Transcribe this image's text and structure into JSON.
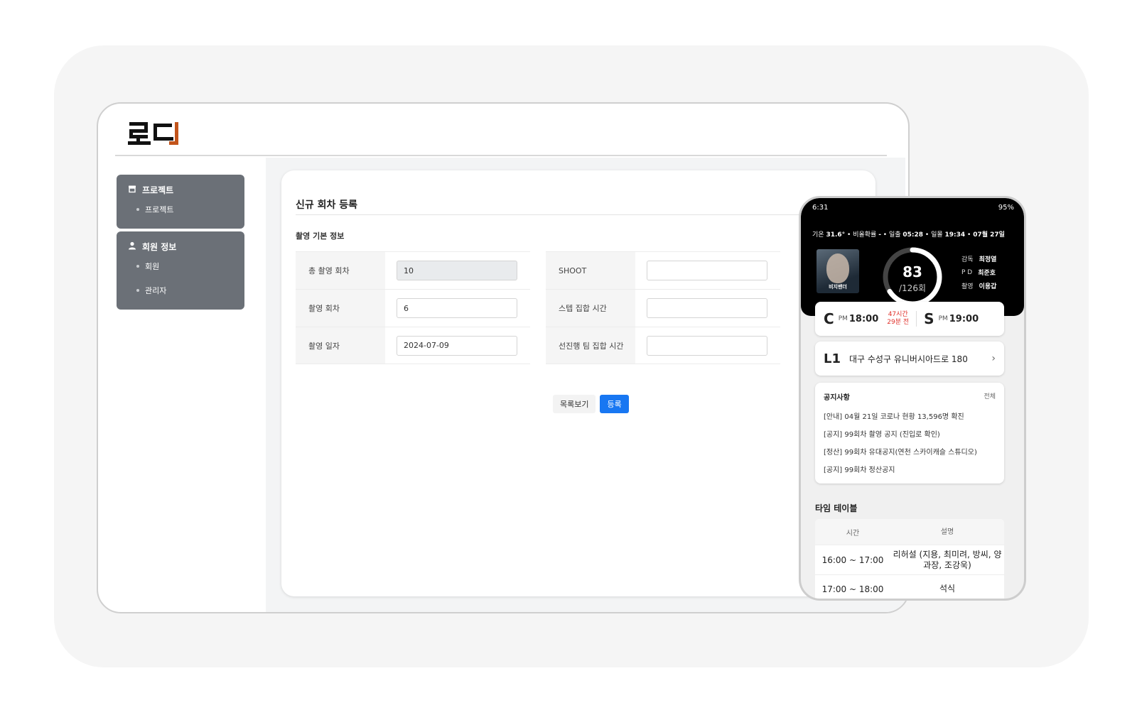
{
  "app": {
    "logo_text": "로디"
  },
  "sidebar": {
    "groups": [
      {
        "label": "프로젝트",
        "icon": "store-icon",
        "items": [
          {
            "label": "프로젝트"
          }
        ]
      },
      {
        "label": "회원 정보",
        "icon": "person-icon",
        "items": [
          {
            "label": "회원"
          },
          {
            "label": "관리자"
          }
        ]
      }
    ]
  },
  "form": {
    "title": "신규 회차 등록",
    "section_title": "촬영 기본 정보",
    "left_fields": [
      {
        "label": "총 촬영 회차",
        "value": "10",
        "disabled": true
      },
      {
        "label": "촬영 회차",
        "value": "6"
      },
      {
        "label": "촬영 일자",
        "value": "2024-07-09"
      }
    ],
    "right_fields": [
      {
        "label": "SHOOT",
        "value": ""
      },
      {
        "label": "스텝 집합 시간",
        "value": ""
      },
      {
        "label": "선진행 팀 집합 시간",
        "value": ""
      }
    ],
    "list_button": "목록보기",
    "submit_button": "등록"
  },
  "phone": {
    "status": {
      "time": "6:31",
      "battery": "95%"
    },
    "weather": {
      "temp_label": "기온",
      "temp": "31.6°",
      "rain_label": "비올확률",
      "rain": "-",
      "sunrise_label": "일출",
      "sunrise": "05:28",
      "sunset_label": "일몰",
      "sunset": "19:34",
      "date": "07월 27일"
    },
    "poster_title": "비지밴더",
    "progress": {
      "current": "83",
      "total": "/126회",
      "fraction": 0.6587
    },
    "crew": [
      {
        "role": "감독",
        "name": "최정열"
      },
      {
        "role": "P D",
        "name": "최준호"
      },
      {
        "role": "촬영",
        "name": "이용갑"
      }
    ],
    "call": {
      "c_letter": "C",
      "c_pm": "PM",
      "c_time": "18:00",
      "remain_1": "47시간",
      "remain_2": "29분 전",
      "s_letter": "S",
      "s_pm": "PM",
      "s_time": "19:00"
    },
    "location": {
      "code": "L1",
      "address": "대구 수성구 유니버시아드로 180",
      "arrow": "›"
    },
    "notice": {
      "title": "공지사항",
      "all": "전체",
      "items": [
        "[안내] 04월 21일 코로나 현황 13,596명 확진",
        "[공지] 99회차 촬영 공지 (진입로 확인)",
        "[정산] 99회차 유대공지(연천 스카이캐슬 스튜디오)",
        "[공지] 99회차 정산공지"
      ]
    },
    "timetable": {
      "title": "타임 테이블",
      "col_time": "시간",
      "col_desc": "설명",
      "rows": [
        {
          "time": "16:00 ~ 17:00",
          "desc": "리허설 (지용, 최미려, 방씨, 양과장, 조강욱)"
        },
        {
          "time": "17:00 ~ 18:00",
          "desc": "석식"
        }
      ]
    }
  }
}
